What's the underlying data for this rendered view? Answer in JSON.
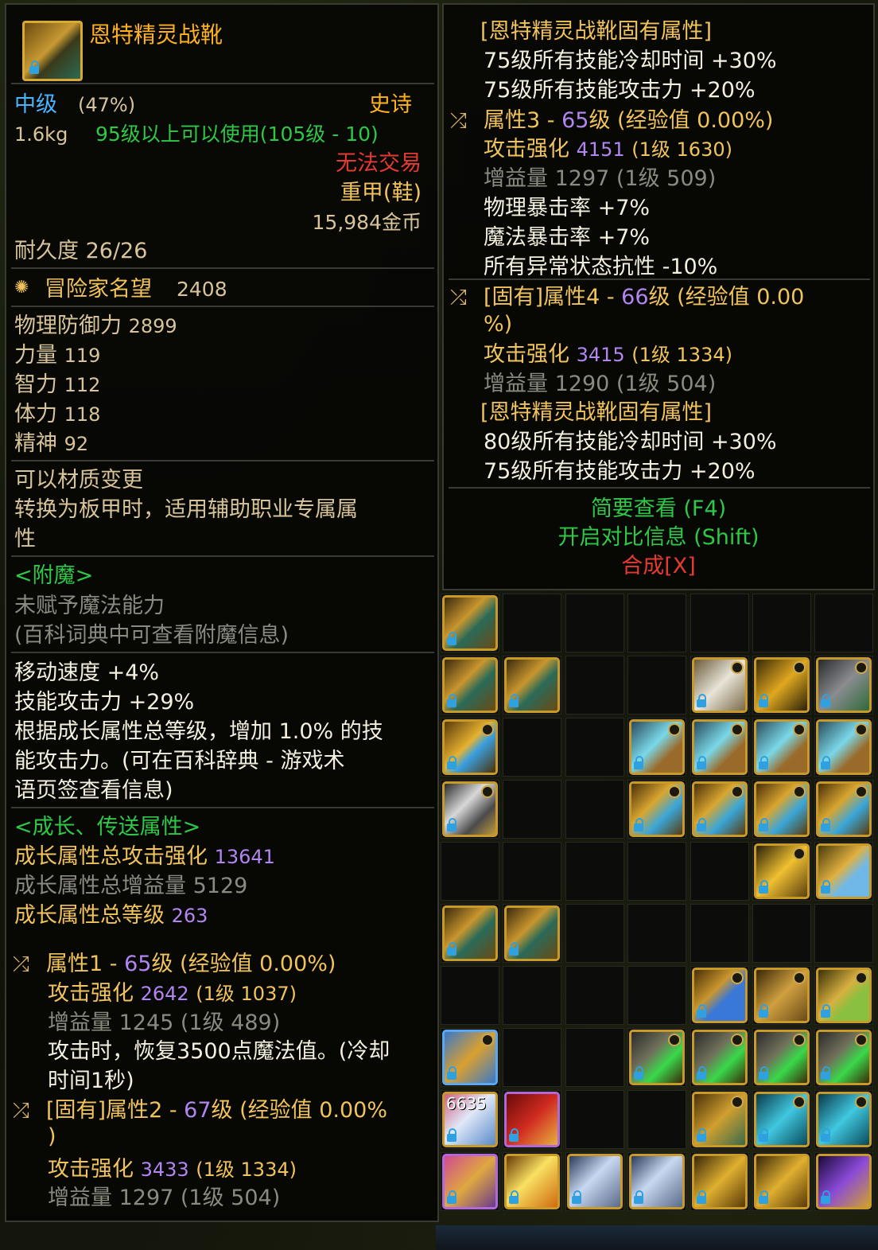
{
  "item": {
    "name": "恩特精灵战靴",
    "grade": "中级",
    "grade_pct": "(47%)",
    "rarity": "史诗",
    "weight": "1.6kg",
    "requirement": "95级以上可以使用(105级 - 10)",
    "trade": "无法交易",
    "type": "重甲(鞋)",
    "price": "15,984金币",
    "durability": "耐久度 26/26",
    "fame_label": "冒险家名望",
    "fame_value": "2408",
    "stats": [
      {
        "label": "物理防御力",
        "value": "2899"
      },
      {
        "label": "力量",
        "value": "119"
      },
      {
        "label": "智力",
        "value": "112"
      },
      {
        "label": "体力",
        "value": "118"
      },
      {
        "label": "精神",
        "value": "92"
      }
    ],
    "material_title": "可以材质变更",
    "material_desc_1": "转换为板甲时，适用辅助职业专属属",
    "material_desc_2": "性",
    "enchant_title": "<附魔>",
    "enchant_none": "未赋予魔法能力",
    "enchant_hint": "(百科词典中可查看附魔信息)",
    "move_speed": "移动速度 +4%",
    "skill_atk": "技能攻击力 +29%",
    "growth_desc_1": "根据成长属性总等级，增加 1.0% 的技",
    "growth_desc_2": "能攻击力。(可在百科辞典 - 游戏术",
    "growth_desc_3": "语页签查看信息)",
    "growth_title": "<成长、传送属性>",
    "growth_total_atk_label": "成长属性总攻击强化",
    "growth_total_atk": "13641",
    "growth_total_buff": "成长属性总增益量 5129",
    "growth_total_lv_label": "成长属性总等级",
    "growth_total_lv": "263"
  },
  "attr1": {
    "prefix": "属性1 - ",
    "lv": "65",
    "suffix": "级 (经验值 0.00%)",
    "atk_label": "攻击强化",
    "atk": "2642",
    "atk_lv": "(1级 1037)",
    "buff": "增益量 1245 (1级 489)",
    "effect_1": "攻击时，恢复3500点魔法值。(冷却",
    "effect_2": "时间1秒)"
  },
  "attr2": {
    "prefix": "[固有]属性2 - ",
    "lv": "67",
    "suffix": "级 (经验值 0.00%",
    "suffix_2": ")",
    "atk_label": "攻击强化",
    "atk": "3433",
    "atk_lv": "(1级 1334)",
    "buff": "增益量 1297 (1级 504)"
  },
  "right": {
    "inherent_title": "[恩特精灵战靴固有属性]",
    "inh1": "75级所有技能冷却时间 +30%",
    "inh2": "75级所有技能攻击力 +20%",
    "attr3_prefix": "属性3 - ",
    "attr3_lv": "65",
    "attr3_suffix": "级 (经验值 0.00%)",
    "attr3_atk_label": "攻击强化",
    "attr3_atk": "4151",
    "attr3_atk_lv": "(1级 1630)",
    "attr3_buff": "增益量 1297 (1级 509)",
    "attr3_e1": "物理暴击率 +7%",
    "attr3_e2": "魔法暴击率 +7%",
    "attr3_e3": "所有异常状态抗性 -10%",
    "attr4_prefix": "[固有]属性4 - ",
    "attr4_lv": "66",
    "attr4_suffix": "级 (经验值 0.00",
    "attr4_suffix_2": "%)",
    "attr4_atk_label": "攻击强化",
    "attr4_atk": "3415",
    "attr4_atk_lv": "(1级 1334)",
    "attr4_buff": "增益量 1290 (1级 504)",
    "inherent_title_2": "[恩特精灵战靴固有属性]",
    "inh3": "80级所有技能冷却时间 +30%",
    "inh4": "75级所有技能攻击力 +20%",
    "brief": "简要查看 (F4)",
    "compare": "开启对比信息 (Shift)",
    "compose": "合成[X]"
  },
  "inventory": {
    "stack_count": "6635",
    "slots": [
      [
        "armor-gold-green",
        "",
        "",
        "",
        "",
        "",
        ""
      ],
      [
        "armor-gold-green",
        "armor-gold-green",
        "",
        "",
        "wolf-mask",
        "gold-net",
        "robot"
      ],
      [
        "blue-ring",
        "",
        "",
        "gem-pod",
        "gem-pod",
        "gem-pod",
        "gem-pod"
      ],
      [
        "silver-box",
        "",
        "",
        "gem-chalice",
        "gem-chalice",
        "gem-chalice",
        "gem-chalice"
      ],
      [
        "",
        "",
        "",
        "",
        "",
        "gold-horn",
        "potion"
      ],
      [
        "armor-gold-green",
        "armor-gold-green",
        "",
        "",
        "",
        "",
        ""
      ],
      [
        "",
        "",
        "",
        "",
        "blue-star",
        "gold-mask",
        "green-lamp"
      ],
      [
        "gold-boots-blue",
        "",
        "",
        "green-cannon",
        "green-cannon",
        "green-cannon",
        "green-cannon"
      ],
      [
        "ticket-stack",
        "red-charm",
        "",
        "",
        "gold-clock",
        "blue-crystal",
        "blue-crystal"
      ],
      [
        "pink-armor",
        "gold-orb",
        "silver-claw",
        "silver-claw",
        "gold-boots",
        "gold-boots",
        "purple-crystal"
      ]
    ]
  }
}
